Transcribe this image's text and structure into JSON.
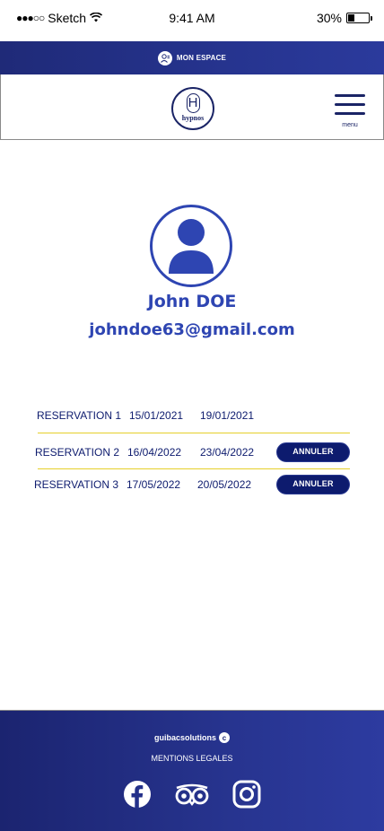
{
  "status_bar": {
    "carrier": "Sketch",
    "time": "9:41 AM",
    "battery": "30%",
    "battery_level": 0.3
  },
  "top_banner": {
    "label": "MON ESPACE",
    "icon": "user-icon"
  },
  "header": {
    "logo_letter": "H",
    "logo_text": "hypnos",
    "menu_label": "menu"
  },
  "profile": {
    "name": "John DOE",
    "email": "johndoe63@gmail.com",
    "avatar_icon": "user-avatar-icon"
  },
  "reservations": [
    {
      "label": "RESERVATION 1",
      "start": "15/01/2021",
      "end": "19/01/2021",
      "cancel_label": null
    },
    {
      "label": "RESERVATION 2",
      "start": "16/04/2022",
      "end": "23/04/2022",
      "cancel_label": "ANNULER"
    },
    {
      "label": "RESERVATION 3",
      "start": "17/05/2022",
      "end": "20/05/2022",
      "cancel_label": "ANNULER"
    }
  ],
  "footer": {
    "brand": "guibacsolutions",
    "copyright_symbol": "c",
    "legal": "MENTIONS LEGALES",
    "social": [
      "facebook-icon",
      "tripadvisor-icon",
      "instagram-icon"
    ]
  },
  "colors": {
    "brand_dark": "#0d1b6e",
    "brand_blue": "#2e45b2",
    "divider": "#e6cf2a"
  }
}
